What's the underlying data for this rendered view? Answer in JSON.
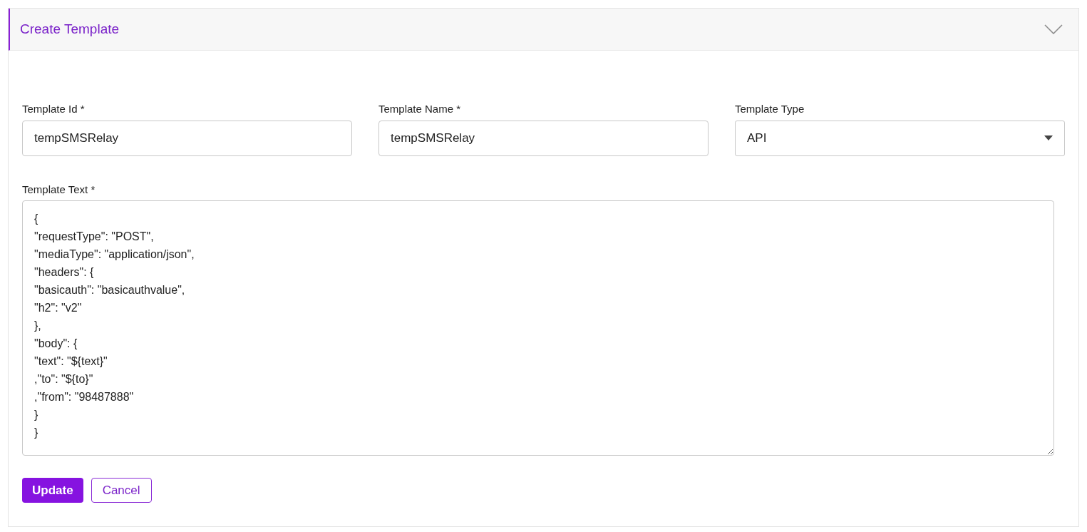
{
  "panel": {
    "title": "Create Template",
    "expanded": true
  },
  "fields": [
    {
      "kind": "text",
      "label": "Template Id *",
      "value": "tempSMSRelay"
    },
    {
      "kind": "text",
      "label": "Template Name *",
      "value": "tempSMSRelay"
    },
    {
      "kind": "select",
      "label": "Template Type",
      "value": "API"
    }
  ],
  "template_text": {
    "label": "Template Text *",
    "value": "{\n\"requestType\": \"POST\",\n\"mediaType\": \"application/json\",\n\"headers\": {\n\"basicauth\": \"basicauthvalue\",\n\"h2\": \"v2\"\n},\n\"body\": {\n\"text\": \"${text}\"\n,\"to\": \"${to}\"\n,\"from\": \"98487888\"\n}\n}"
  },
  "buttons": [
    {
      "kind": "primary",
      "label": "Update"
    },
    {
      "kind": "secondary",
      "label": "Cancel"
    }
  ]
}
